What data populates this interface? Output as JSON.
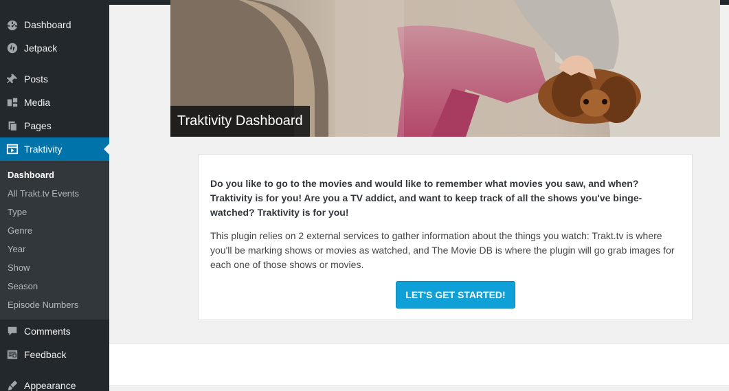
{
  "sidebar": {
    "items": [
      {
        "label": "Dashboard",
        "icon": "dashboard-icon"
      },
      {
        "label": "Jetpack",
        "icon": "jetpack-icon"
      },
      {
        "label": "Posts",
        "icon": "pin-icon"
      },
      {
        "label": "Media",
        "icon": "media-icon"
      },
      {
        "label": "Pages",
        "icon": "pages-icon"
      },
      {
        "label": "Traktivity",
        "icon": "video-icon"
      },
      {
        "label": "Comments",
        "icon": "comment-icon"
      },
      {
        "label": "Feedback",
        "icon": "feedback-icon"
      },
      {
        "label": "Appearance",
        "icon": "brush-icon"
      }
    ],
    "submenu": [
      "Dashboard",
      "All Trakt.tv Events",
      "Type",
      "Genre",
      "Year",
      "Show",
      "Season",
      "Episode Numbers"
    ]
  },
  "hero": {
    "title": "Traktivity Dashboard"
  },
  "card": {
    "lead": "Do you like to go to the movies and would like to remember what movies you saw, and when? Traktivity is for you! Are you a TV addict, and want to keep track of all the shows you've binge-watched? Traktivity is for you!",
    "description": "This plugin relies on 2 external services to gather information about the things you watch: Trakt.tv is where you'll be marking shows or movies as watched, and The Movie DB is where the plugin will go grab images for each one of those shows or movies.",
    "cta_label": "LET'S GET STARTED!"
  },
  "colors": {
    "sidebar_bg": "#23282d",
    "submenu_bg": "#32373c",
    "active": "#0073aa",
    "cta": "#0fa0d8"
  }
}
